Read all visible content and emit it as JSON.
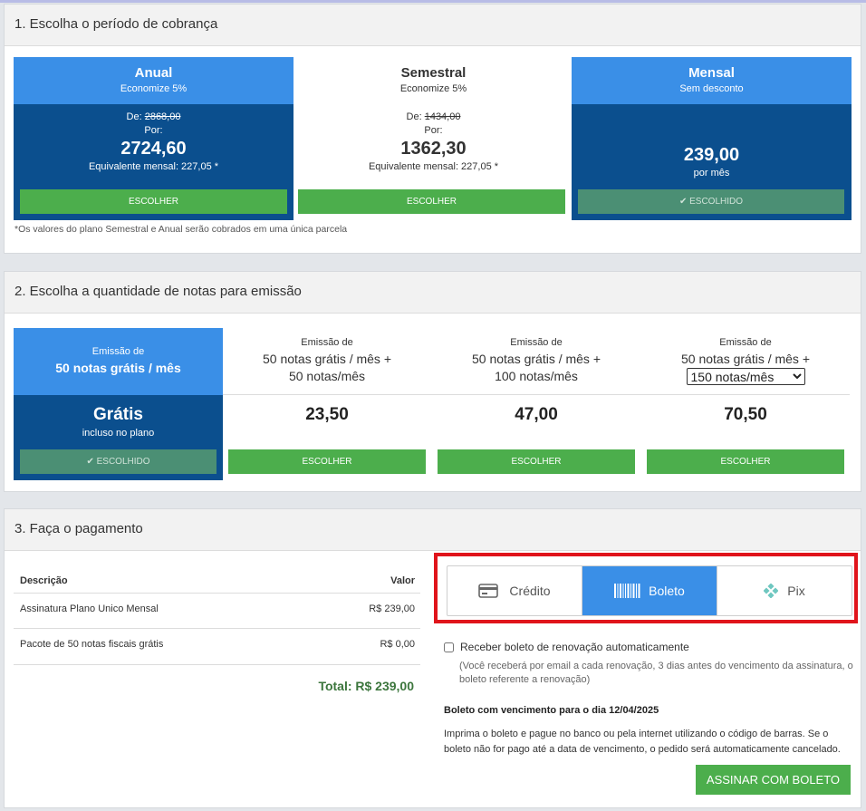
{
  "section1": {
    "title": "1. Escolha o período de cobrança",
    "plans": [
      {
        "name": "Anual",
        "subtitle": "Economize 5%",
        "de_label": "De:",
        "de_value": "2868,00",
        "por_label": "Por:",
        "price": "2724,60",
        "equiv": "Equivalente mensal: 227,05 *",
        "button": "ESCOLHER"
      },
      {
        "name": "Semestral",
        "subtitle": "Economize 5%",
        "de_label": "De:",
        "de_value": "1434,00",
        "por_label": "Por:",
        "price": "1362,30",
        "equiv": "Equivalente mensal: 227,05 *",
        "button": "ESCOLHER"
      },
      {
        "name": "Mensal",
        "subtitle": "Sem desconto",
        "price": "239,00",
        "per": "por mês",
        "button": "ESCOLHIDO"
      }
    ],
    "footnote": "*Os valores do plano Semestral e Anual serão cobrados em uma única parcela"
  },
  "section2": {
    "title": "2. Escolha a quantidade de notas para emissão",
    "options": [
      {
        "line1": "Emissão de",
        "line2": "50 notas grátis / mês",
        "price": "Grátis",
        "sub": "incluso no plano",
        "button": "ESCOLHIDO"
      },
      {
        "line1": "Emissão de",
        "line2": "50 notas grátis / mês +",
        "line3": "50 notas/mês",
        "price": "23,50",
        "button": "ESCOLHER"
      },
      {
        "line1": "Emissão de",
        "line2": "50 notas grátis / mês +",
        "line3": "100 notas/mês",
        "price": "47,00",
        "button": "ESCOLHER"
      },
      {
        "line1": "Emissão de",
        "line2": "50 notas grátis / mês +",
        "select_value": "150 notas/mês",
        "price": "70,50",
        "button": "ESCOLHER"
      }
    ]
  },
  "section3": {
    "title": "3. Faça o pagamento",
    "table": {
      "col_desc": "Descrição",
      "col_value": "Valor",
      "rows": [
        {
          "desc": "Assinatura Plano Unico Mensal",
          "value": "R$ 239,00"
        },
        {
          "desc": "Pacote de 50 notas fiscais grátis",
          "value": "R$ 0,00"
        }
      ],
      "total": "Total: R$ 239,00"
    },
    "methods": [
      {
        "label": "Crédito",
        "icon": "credit-card-icon"
      },
      {
        "label": "Boleto",
        "icon": "barcode-icon"
      },
      {
        "label": "Pix",
        "icon": "pix-icon"
      }
    ],
    "active_method": "Boleto",
    "auto_renew_label": "Receber boleto de renovação automaticamente",
    "auto_renew_note": "(Você receberá por email a cada renovação, 3 dias antes do vencimento da assinatura, o boleto referente a renovação)",
    "due_text": "Boleto com vencimento para o dia 12/04/2025",
    "instructions": "Imprima o boleto e pague no banco ou pela internet utilizando o código de barras. Se o boleto não for pago até a data de vencimento, o pedido será automaticamente cancelado.",
    "submit_label": "ASSINAR COM BOLETO"
  },
  "colors": {
    "accent_blue": "#3a8fe7",
    "dark_blue": "#0b4f8e",
    "green": "#4cae4c",
    "highlight_red": "#e0141b"
  }
}
